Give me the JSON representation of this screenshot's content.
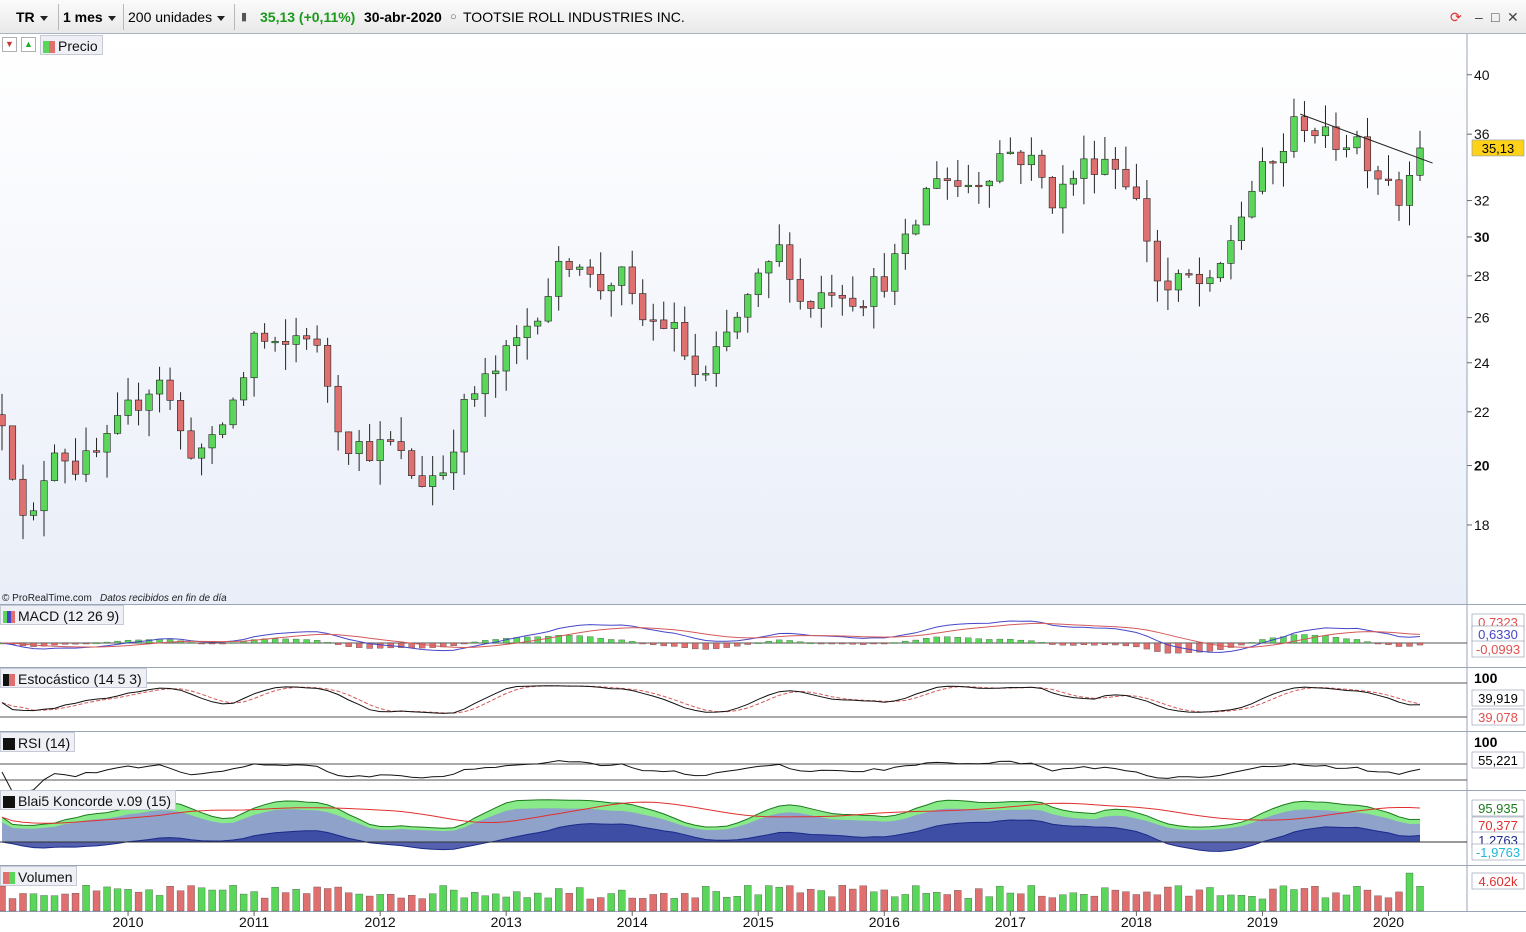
{
  "toolbar": {
    "ticker": "TR",
    "period": "1 mes",
    "units": "200 unidades",
    "price_change": "35,13 (+0,11%)",
    "date": "30-abr-2020",
    "name": "TOOTSIE ROLL INDUSTRIES INC."
  },
  "panels": {
    "price": {
      "label": "Precio",
      "last_value": "35,13"
    },
    "macd": {
      "label": "MACD (12 26 9)",
      "values": [
        "0,7323",
        "0,6330",
        "-0,0993"
      ]
    },
    "stoch": {
      "label": "Estocástico (14 5 3)",
      "top": "100",
      "values": [
        "39,919",
        "39,078"
      ]
    },
    "rsi": {
      "label": "RSI (14)",
      "top": "100",
      "values": [
        "55,221"
      ]
    },
    "koncorde": {
      "label": "Blai5 Koncorde v.09 (15)",
      "values": [
        "95,935",
        "70,377",
        "1,2763",
        "-1,9763"
      ]
    },
    "volume": {
      "label": "Volumen",
      "values": [
        "4.602k"
      ]
    }
  },
  "credit": {
    "source": "© ProRealTime.com",
    "note": "Datos recibidos en fin de día"
  },
  "colors": {
    "up": "#5ad75a",
    "down": "#e07070",
    "label_yellow": "#ffd21a"
  },
  "chart_data": {
    "type": "candlestick",
    "y_ticks": [
      18,
      20,
      22,
      24,
      26,
      28,
      30,
      32,
      36,
      40
    ],
    "y_tick_bold": [
      20,
      30
    ],
    "ylim": [
      16.5,
      41.5
    ],
    "y_scale": "log",
    "x_tick_labels": [
      "2010",
      "2011",
      "2012",
      "2013",
      "2014",
      "2015",
      "2016",
      "2017",
      "2018",
      "2019",
      "2020"
    ],
    "start_year": 2009.0,
    "end_year": 2020.25,
    "series": [
      {
        "name": "Precio",
        "anchors": [
          [
            2009.0,
            21.9
          ],
          [
            2009.2,
            17.3
          ],
          [
            2009.4,
            20.9
          ],
          [
            2009.6,
            19.9
          ],
          [
            2009.8,
            20.5
          ],
          [
            2010.0,
            22.0
          ],
          [
            2010.25,
            23.5
          ],
          [
            2010.45,
            20.7
          ],
          [
            2010.65,
            20.5
          ],
          [
            2010.9,
            23.1
          ],
          [
            2011.0,
            25.2
          ],
          [
            2011.2,
            24.3
          ],
          [
            2011.4,
            25.6
          ],
          [
            2011.55,
            23.8
          ],
          [
            2011.7,
            21.0
          ],
          [
            2011.9,
            20.6
          ],
          [
            2012.1,
            20.7
          ],
          [
            2012.3,
            19.4
          ],
          [
            2012.5,
            19.9
          ],
          [
            2012.7,
            22.5
          ],
          [
            2012.9,
            23.5
          ],
          [
            2013.1,
            25.0
          ],
          [
            2013.3,
            27.0
          ],
          [
            2013.55,
            29.4
          ],
          [
            2013.7,
            27.3
          ],
          [
            2013.9,
            28.1
          ],
          [
            2014.05,
            25.9
          ],
          [
            2014.3,
            25.7
          ],
          [
            2014.55,
            22.9
          ],
          [
            2014.75,
            25.1
          ],
          [
            2015.0,
            27.6
          ],
          [
            2015.2,
            29.6
          ],
          [
            2015.35,
            26.4
          ],
          [
            2015.6,
            27.6
          ],
          [
            2015.8,
            26.9
          ],
          [
            2016.0,
            27.9
          ],
          [
            2016.2,
            29.8
          ],
          [
            2016.4,
            33.8
          ],
          [
            2016.6,
            32.8
          ],
          [
            2016.8,
            33.5
          ],
          [
            2016.95,
            35.1
          ],
          [
            2017.15,
            34.4
          ],
          [
            2017.35,
            32.0
          ],
          [
            2017.55,
            33.9
          ],
          [
            2017.75,
            34.6
          ],
          [
            2017.9,
            33.7
          ],
          [
            2018.05,
            30.9
          ],
          [
            2018.2,
            27.0
          ],
          [
            2018.4,
            27.9
          ],
          [
            2018.6,
            27.2
          ],
          [
            2018.75,
            29.9
          ],
          [
            2018.95,
            33.2
          ],
          [
            2019.1,
            34.2
          ],
          [
            2019.3,
            37.2
          ],
          [
            2019.5,
            35.6
          ],
          [
            2019.75,
            35.7
          ],
          [
            2019.9,
            33.6
          ],
          [
            2020.05,
            33.6
          ],
          [
            2020.1,
            31.1
          ],
          [
            2020.2,
            35.9
          ],
          [
            2020.25,
            35.13
          ]
        ]
      }
    ],
    "trendline": [
      [
        2019.3,
        37.3
      ],
      [
        2020.35,
        34.2
      ]
    ],
    "indicators": [
      "MACD (12 26 9)",
      "Estocástico (14 5 3)",
      "RSI (14)",
      "Blai5 Koncorde v.09 (15)",
      "Volumen"
    ]
  }
}
